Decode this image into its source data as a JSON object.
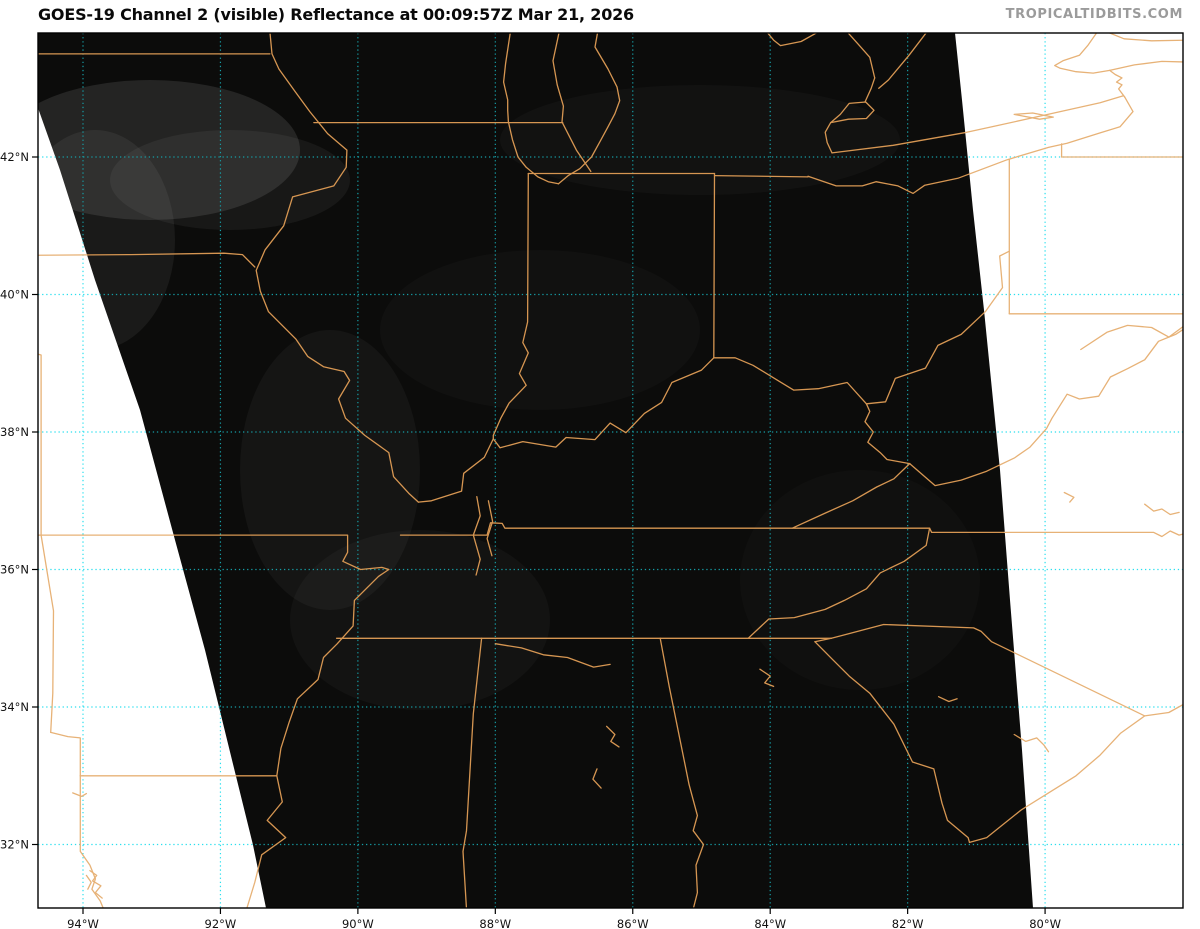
{
  "header": {
    "title": "GOES-19 Channel 2 (visible) Reflectance at 00:09:57Z Mar 21, 2026",
    "watermark": "TROPICALTIDBITS.COM"
  },
  "axes": {
    "lat_labels": [
      "42°N",
      "40°N",
      "38°N",
      "36°N",
      "34°N",
      "32°N"
    ],
    "lon_labels": [
      "94°W",
      "92°W",
      "90°W",
      "88°W",
      "86°W",
      "84°W",
      "82°W",
      "80°W"
    ]
  },
  "colors": {
    "background": "#ffffff",
    "satellite_dark": "#0c0c0b",
    "no_data": "#ffffff",
    "border_on_dark": "#d69652",
    "border_on_light": "#e7b277",
    "grid_on_dark": "#169da5",
    "grid_on_light": "#2adfee",
    "frame": "#000000",
    "title_text": "#0a0a0a",
    "axis_text": "#111111",
    "watermark_text": "#9b9b9b"
  }
}
